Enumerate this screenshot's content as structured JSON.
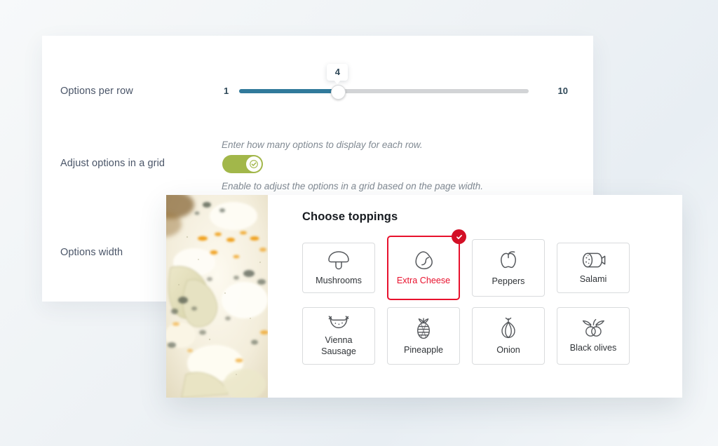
{
  "settings": {
    "rows": [
      {
        "label": "Options per row",
        "helper": "Enter how many options to display for each row.",
        "slider": {
          "value": "4",
          "min": "1",
          "max": "10",
          "fill_percent": 34
        }
      },
      {
        "label": "Adjust options in a grid",
        "helper": "Enable to adjust the options in a grid based on the page width.",
        "toggle": {
          "state": "on"
        }
      },
      {
        "label": "Options width"
      }
    ]
  },
  "toppings_panel": {
    "title": "Choose toppings",
    "photo_alt": "pizza-photo",
    "items": [
      {
        "label": "Mushrooms",
        "icon": "mushroom-icon",
        "selected": false,
        "tall": false
      },
      {
        "label": "Extra Cheese",
        "icon": "cheese-icon",
        "selected": true,
        "tall": false
      },
      {
        "label": "Peppers",
        "icon": "pepper-icon",
        "selected": false,
        "tall": true
      },
      {
        "label": "Salami",
        "icon": "salami-icon",
        "selected": false,
        "tall": false
      },
      {
        "label": "Vienna\nSausage",
        "icon": "sausage-icon",
        "selected": false,
        "tall": true
      },
      {
        "label": "Pineapple",
        "icon": "pineapple-icon",
        "selected": false,
        "tall": true
      },
      {
        "label": "Onion",
        "icon": "onion-icon",
        "selected": false,
        "tall": true
      },
      {
        "label": "Black olives",
        "icon": "olives-icon",
        "selected": false,
        "tall": true
      }
    ]
  },
  "colors": {
    "slider_fill": "#317a9b",
    "slider_track": "#d2d4d6",
    "toggle_on": "#a2b74a",
    "selected_border": "#e8112d",
    "badge": "#d30f26",
    "panel_bg": "#ffffff"
  }
}
